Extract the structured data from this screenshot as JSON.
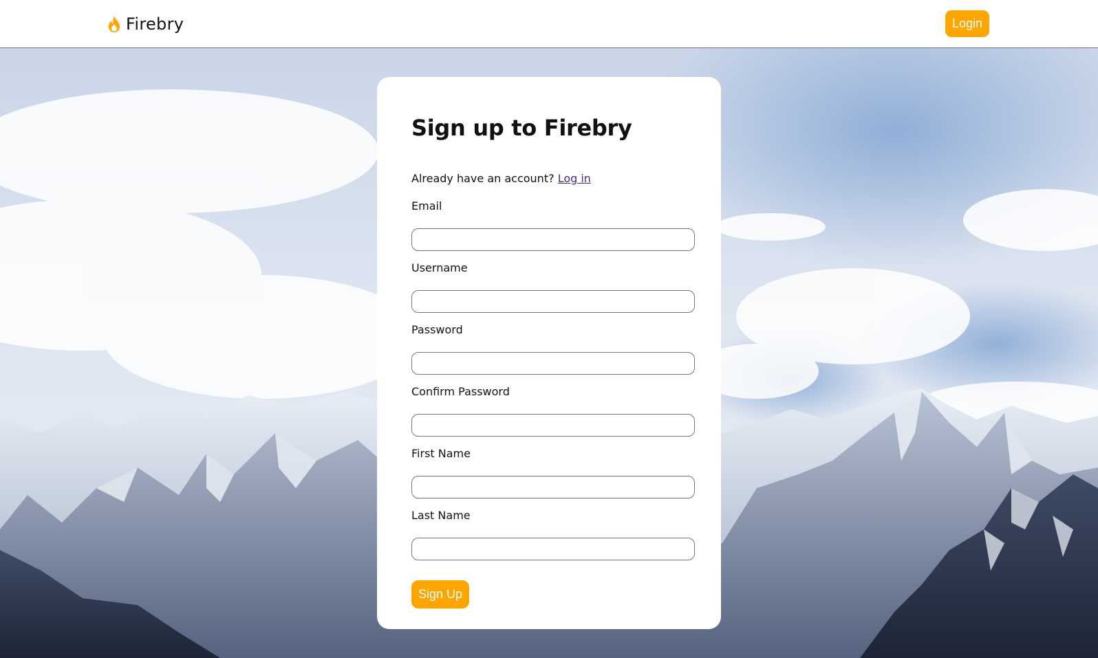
{
  "navbar": {
    "brand_name": "Firebry",
    "brand_icon": "flame-icon",
    "login_label": "Login"
  },
  "form": {
    "title": "Sign up to Firebry",
    "already_text": "Already have an account?",
    "login_link": "Log in",
    "fields": [
      {
        "label": "Email",
        "value": ""
      },
      {
        "label": "Username",
        "value": ""
      },
      {
        "label": "Password",
        "value": ""
      },
      {
        "label": "Confirm Password",
        "value": ""
      },
      {
        "label": "First Name",
        "value": ""
      },
      {
        "label": "Last Name",
        "value": ""
      }
    ],
    "submit_label": "Sign Up"
  },
  "colors": {
    "accent": "#FFA500",
    "link": "#4b2a83"
  }
}
